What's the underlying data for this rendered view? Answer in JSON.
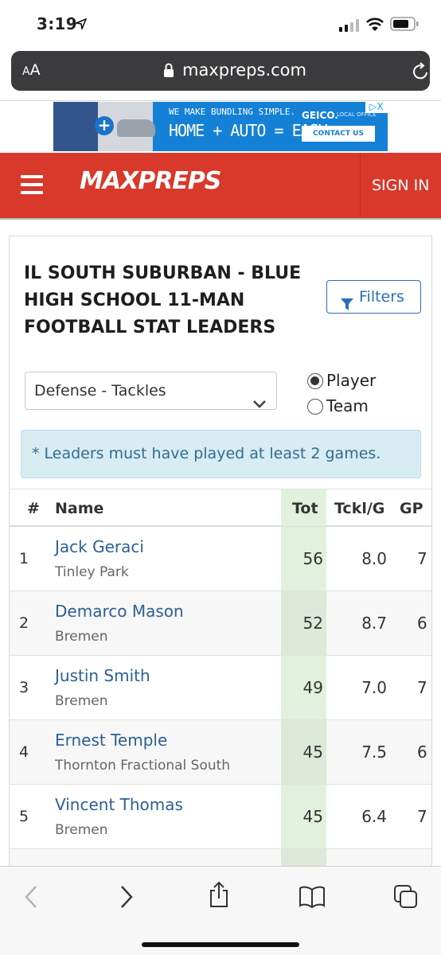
{
  "status_bar": {
    "time": "3:19"
  },
  "browser": {
    "text_size_label_small": "A",
    "text_size_label_large": "A",
    "domain": "maxpreps.com"
  },
  "ad": {
    "headline_small": "WE MAKE BUNDLING SIMPLE.",
    "headline_big": "HOME + AUTO = EASY",
    "brand": "GEICO.",
    "brand_sub": "LOCAL OFFICE",
    "cta": "CONTACT US",
    "close_label": "▷X"
  },
  "header": {
    "logo_text": "MAXPREPS",
    "sign_in": "SIGN IN"
  },
  "page": {
    "title": "IL SOUTH SUBURBAN - BLUE HIGH SCHOOL 11-MAN FOOTBALL STAT LEADERS",
    "filters_label": "Filters",
    "stat_select_value": "Defense - Tackles",
    "radio_player": "Player",
    "radio_team": "Team",
    "notice": "* Leaders must have played at least 2 games."
  },
  "table": {
    "headers": {
      "rank": "#",
      "name": "Name",
      "tot": "Tot",
      "tpg": "Tckl/G",
      "gp": "GP"
    },
    "rows": [
      {
        "rank": "1",
        "name": "Jack Geraci",
        "school": "Tinley Park",
        "tot": "56",
        "tpg": "8.0",
        "gp": "7"
      },
      {
        "rank": "2",
        "name": "Demarco Mason",
        "school": "Bremen",
        "tot": "52",
        "tpg": "8.7",
        "gp": "6"
      },
      {
        "rank": "3",
        "name": "Justin Smith",
        "school": "Bremen",
        "tot": "49",
        "tpg": "7.0",
        "gp": "7"
      },
      {
        "rank": "4",
        "name": "Ernest Temple",
        "school": "Thornton Fractional South",
        "tot": "45",
        "tpg": "7.5",
        "gp": "6"
      },
      {
        "rank": "5",
        "name": "Vincent Thomas",
        "school": "Bremen",
        "tot": "45",
        "tpg": "6.4",
        "gp": "7"
      }
    ]
  },
  "colors": {
    "header_red": "#d8392b",
    "link_blue": "#2c5f95",
    "tot_highlight": "#e2f1de",
    "notice_bg": "#d8ecf4"
  },
  "icons": {
    "back": "chevron-left-icon",
    "forward": "chevron-right-icon",
    "share": "share-icon",
    "bookmarks": "book-icon",
    "tabs": "tabs-icon"
  }
}
